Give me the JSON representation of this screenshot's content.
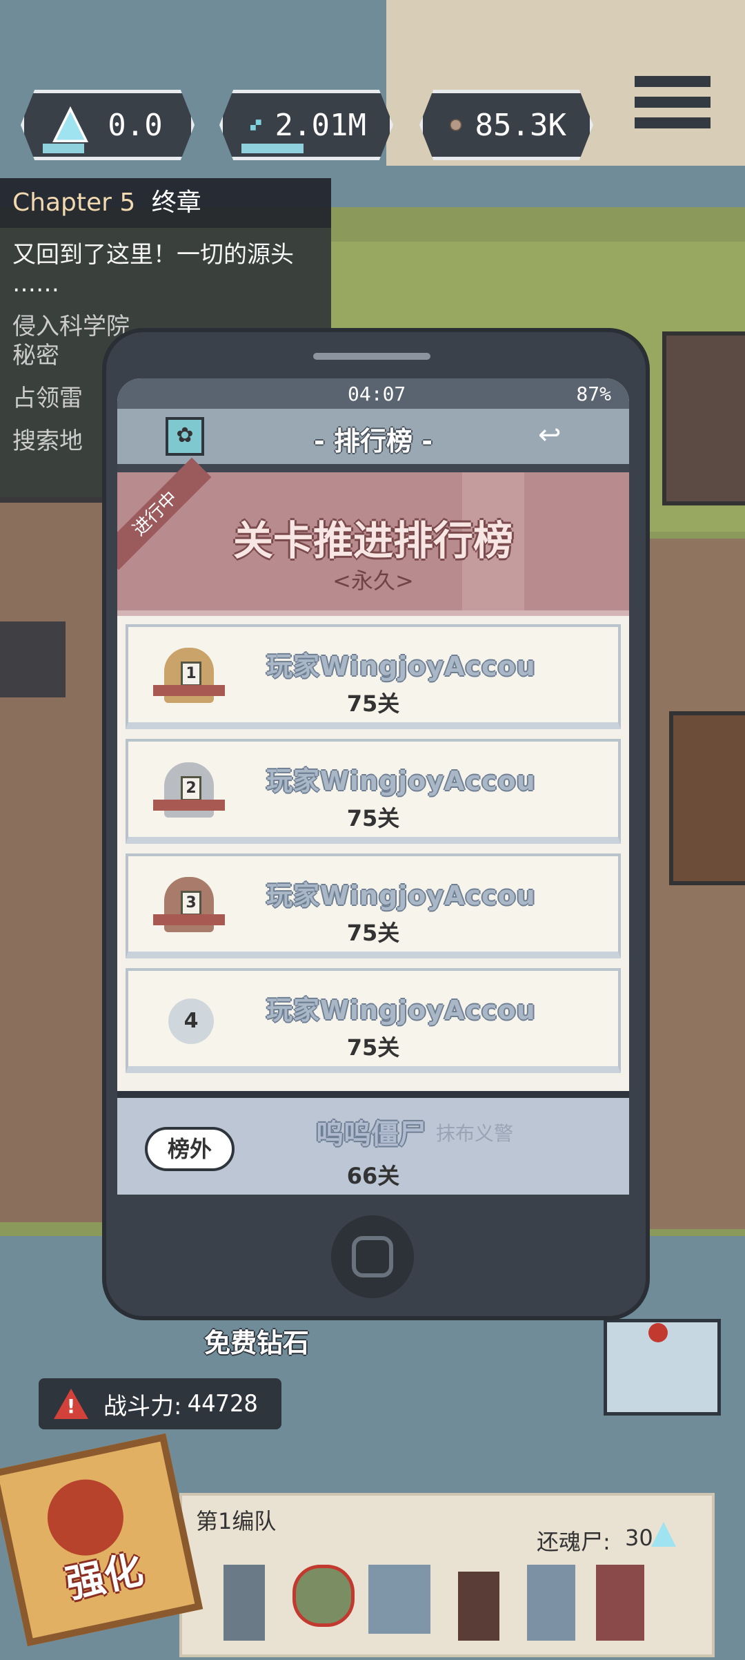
{
  "resources": [
    {
      "icon": "diamond-icon",
      "value": "0.0"
    },
    {
      "icon": "link-chain-icon",
      "value": "2.01M"
    },
    {
      "icon": "coin-icon",
      "value": "85.3K"
    }
  ],
  "quest": {
    "chapter": "Chapter 5",
    "chapter_title": "终章",
    "lines": [
      "又回到了这里！一切的源头",
      "……",
      "侵入科学院",
      "秘密",
      "占领雷",
      "搜索地"
    ]
  },
  "phone": {
    "time": "04:07",
    "battery": "87%",
    "title": "- 排行榜 -",
    "banner": {
      "tag": "进行中",
      "title": "关卡推进排行榜",
      "subtitle": "<永久>"
    },
    "ranks": [
      {
        "rank": "1",
        "name": "玩家WingjoyAccou",
        "level": "75关"
      },
      {
        "rank": "2",
        "name": "玩家WingjoyAccou",
        "level": "75关"
      },
      {
        "rank": "3",
        "name": "玩家WingjoyAccou",
        "level": "75关"
      },
      {
        "rank": "4",
        "name": "玩家WingjoyAccou",
        "level": "75关"
      }
    ],
    "self": {
      "badge": "榜外",
      "name": "呜呜僵尸",
      "title": "抹布义警",
      "level": "66关"
    }
  },
  "free_diamond": "免费钻石",
  "power": {
    "label": "战斗力:",
    "value": "44728"
  },
  "team": {
    "name": "第1编队",
    "revive_label": "还魂尸:",
    "revive_value": "30"
  },
  "strengthen": "强化",
  "colors": {
    "accent_gold": "#e2b063",
    "banner_pink": "#b88b8e",
    "panel_dark": "#3b414b"
  }
}
